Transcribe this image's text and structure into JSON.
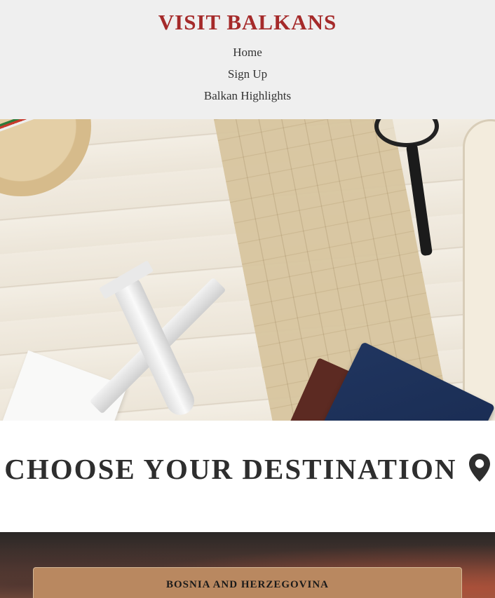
{
  "header": {
    "brand": "VISIT BALKANS",
    "nav": [
      "Home",
      "Sign Up",
      "Balkan Highlights"
    ],
    "brand_color": "#a52a2a",
    "background": "#efefef"
  },
  "hero": {
    "icon": "travel-flatlay-image"
  },
  "destination": {
    "title": "CHOOSE YOUR DESTINATION",
    "icon": "map-pin-icon"
  },
  "countries": [
    {
      "name": "BOSNIA AND HERZEGOVINA"
    }
  ]
}
